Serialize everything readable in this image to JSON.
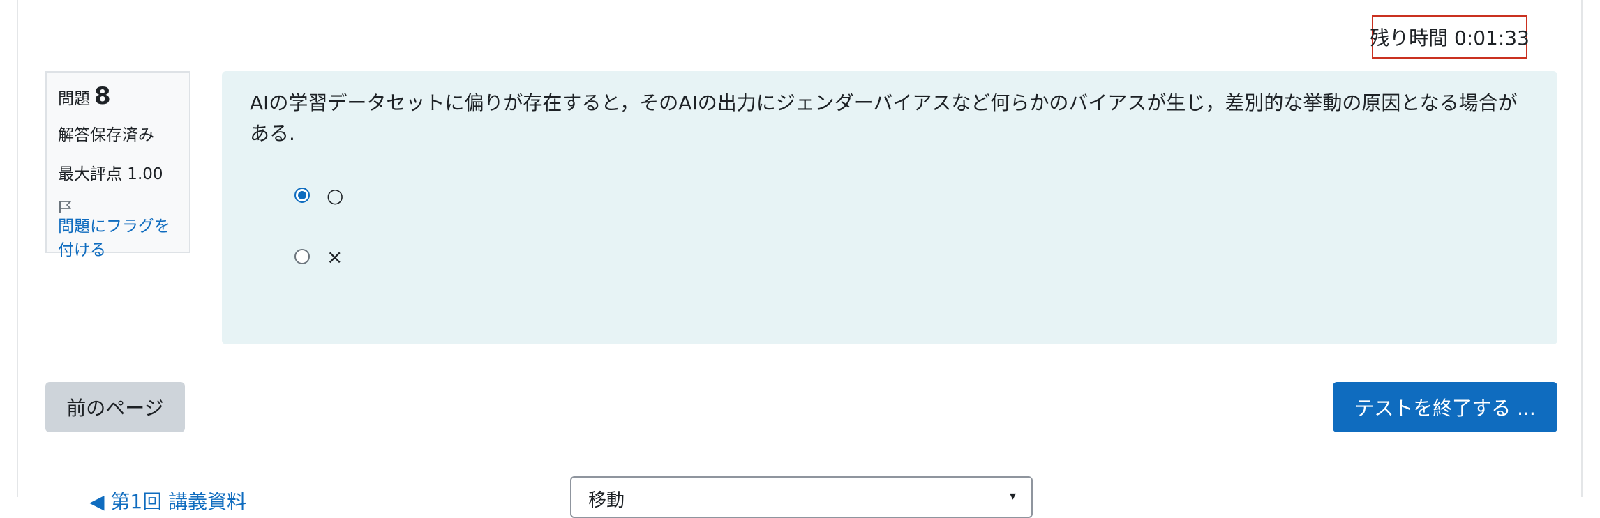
{
  "timer": {
    "text": "残り時間 0:01:33"
  },
  "question_info": {
    "label": "問題",
    "number": "8",
    "status": "解答保存済み",
    "max_grade": "最大評点 1.00",
    "flag_label": "問題にフラグを付ける"
  },
  "question": {
    "text": "AIの学習データセットに偏りが存在すると，そのAIの出力にジェンダーバイアスなど何らかのバイアスが生じ，差別的な挙動の原因となる場合がある."
  },
  "answers": [
    {
      "label": "○",
      "selected": true
    },
    {
      "label": "×",
      "selected": false
    }
  ],
  "navigation": {
    "prev_label": "前のページ",
    "finish_label": "テストを終了する ..."
  },
  "activity_nav": {
    "prev_activity": "◀ 第1回 講義資料",
    "jump_label": "移動"
  },
  "colors": {
    "accent": "#0f6cbf",
    "timer_border": "#ca3120",
    "question_bg": "#e7f3f5"
  },
  "icons": {
    "flag": "flag-icon",
    "select_chevron": "chevron-down-icon"
  }
}
